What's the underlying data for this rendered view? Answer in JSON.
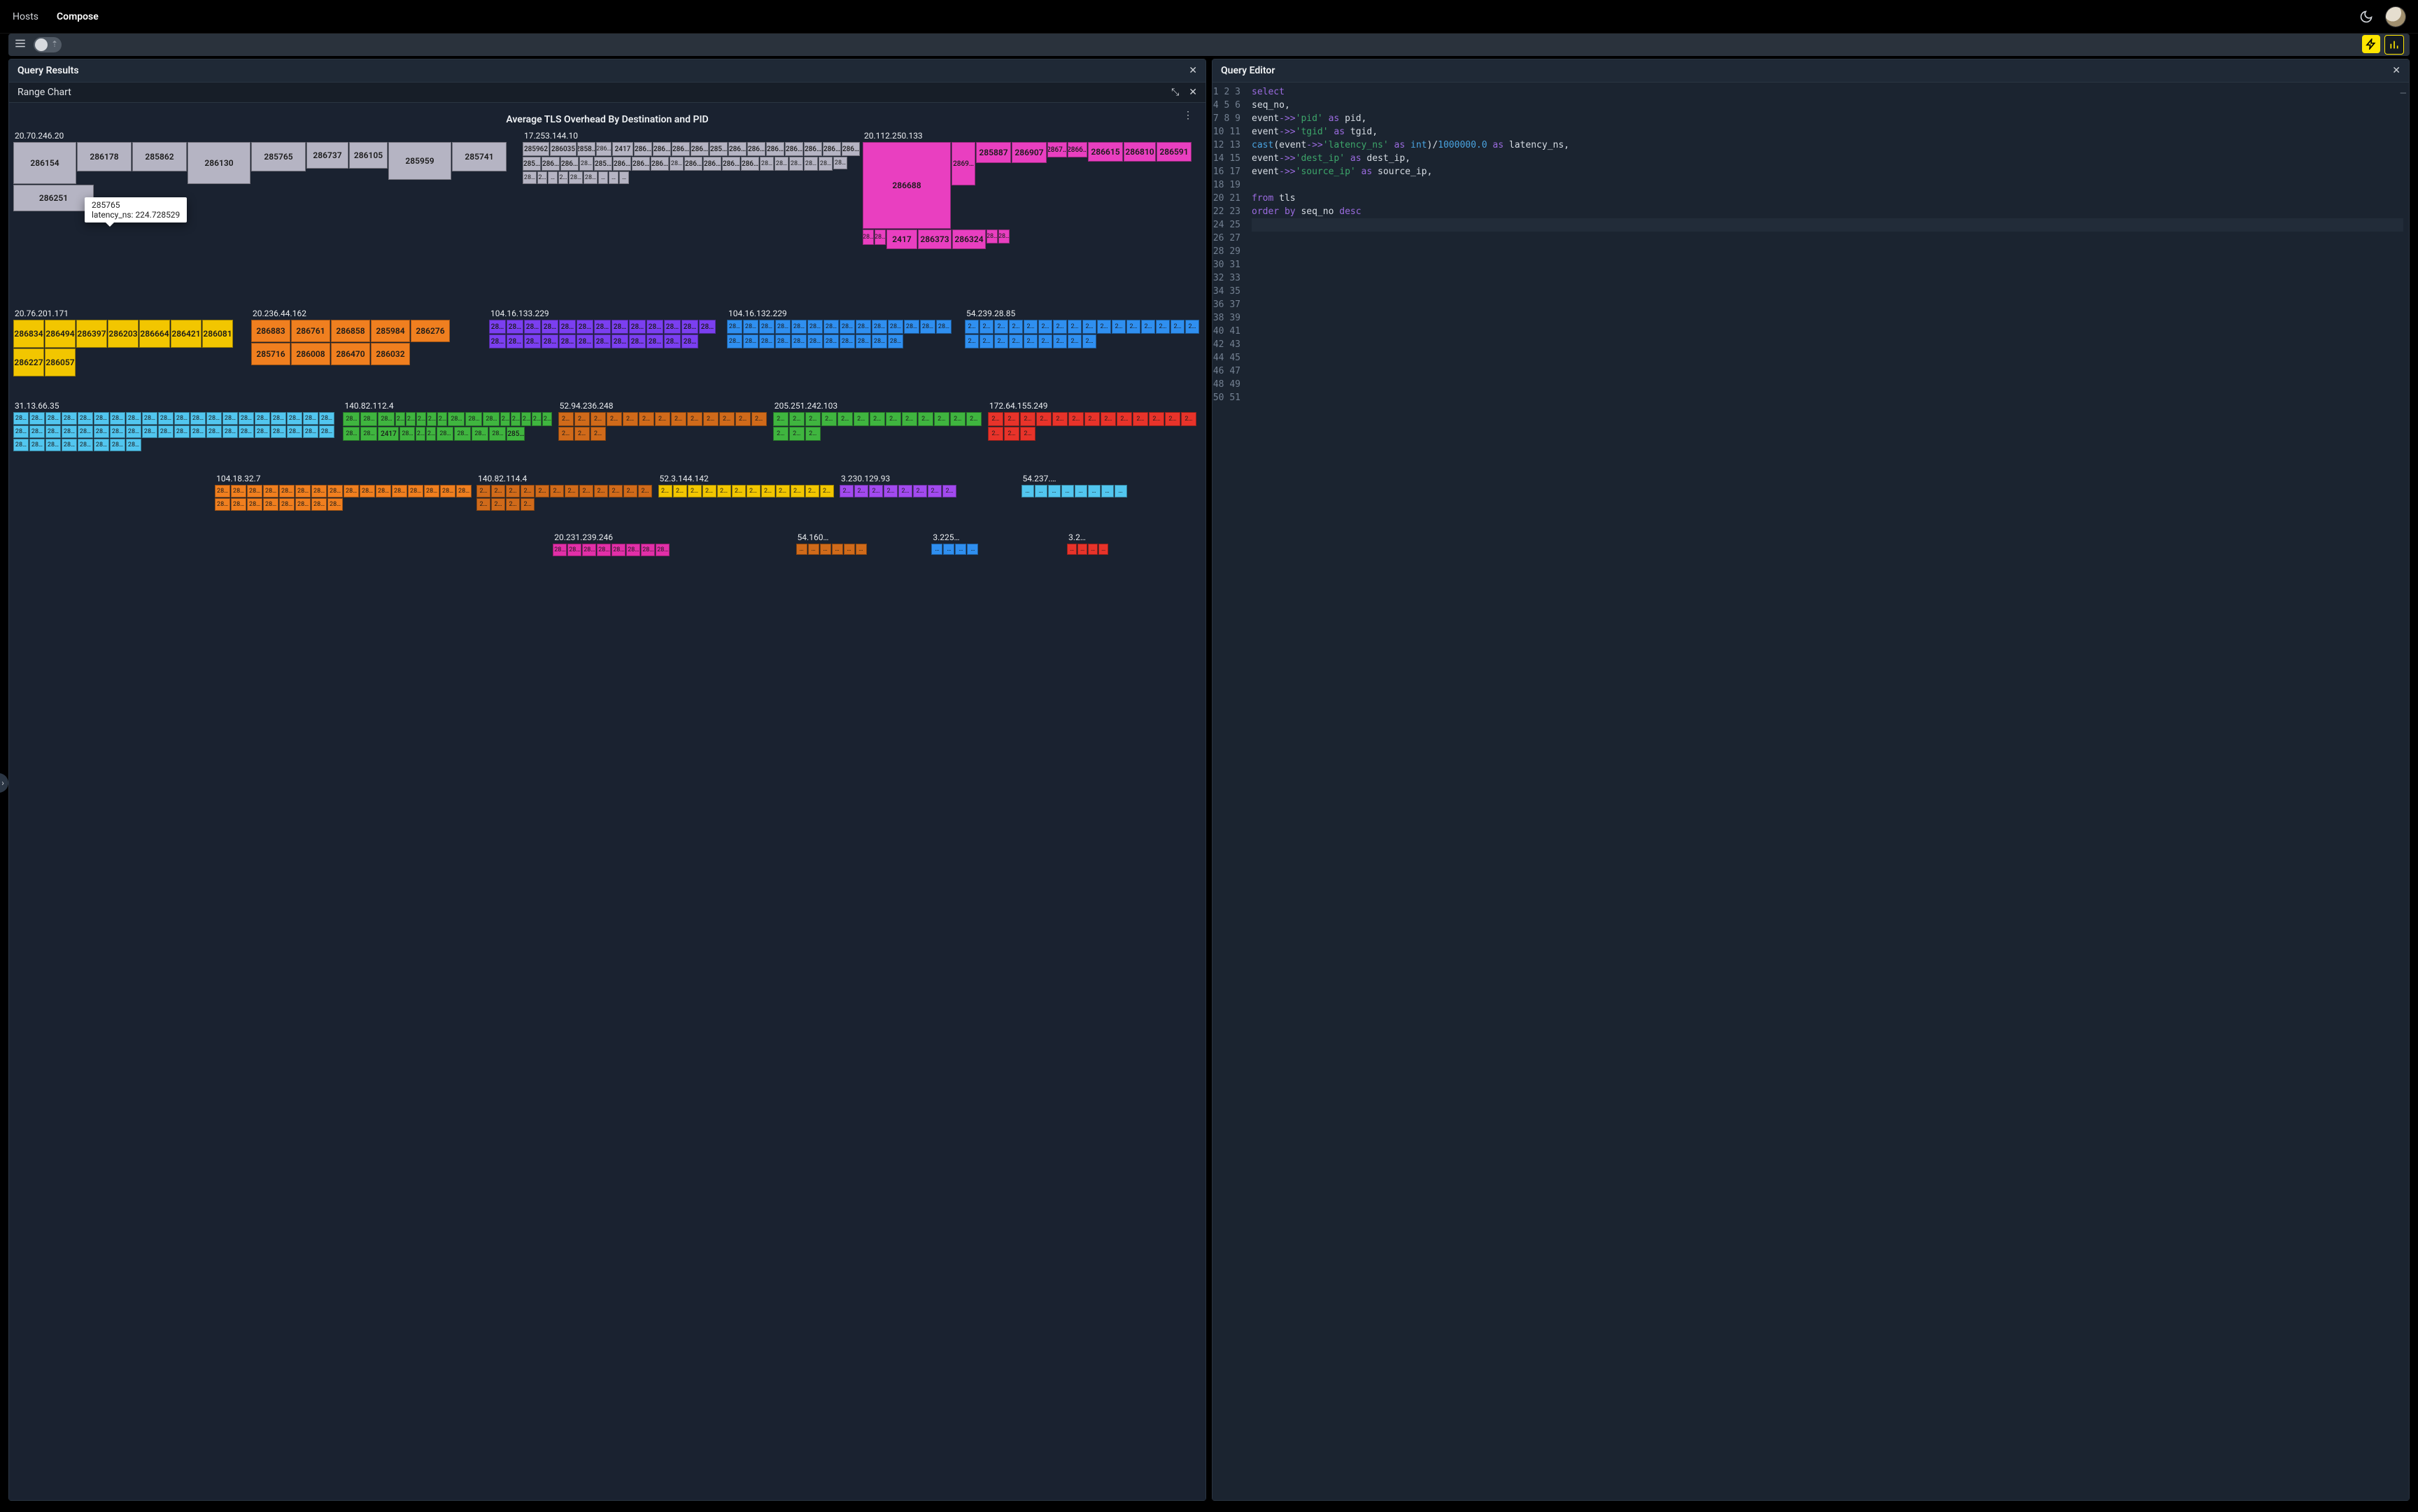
{
  "nav": {
    "hosts": "Hosts",
    "compose": "Compose"
  },
  "panes": {
    "results_title": "Query Results",
    "editor_title": "Query Editor",
    "chart_tab": "Range Chart"
  },
  "chart": {
    "title": "Average TLS Overhead By Destination and PID"
  },
  "tooltip": {
    "pid": "285765",
    "line": "latency_ns: 224.728529"
  },
  "query": {
    "lines": [
      "select",
      "seq_no,",
      "event->>'pid' as pid,",
      "event->>'tgid' as tgid,",
      "cast(event->>'latency_ns' as int)/1000000.0 as latency_ns,",
      "event->>'dest_ip' as dest_ip,",
      "event->>'source_ip' as source_ip,",
      "",
      "from tls",
      "order by seq_no desc",
      ""
    ],
    "total_lines": 51
  },
  "colors": {
    "c1": "#b5b4c3",
    "c2": "#b5b4c3",
    "c-pink": "#e93fc0",
    "c-orange": "#f07f1f",
    "c-yellow": "#f2c600",
    "c-blue": "#2f8ff0",
    "c-purple": "#7b3ff0",
    "c-sky": "#52c6ef",
    "c-green": "#3fb53f",
    "c-brown": "#d06a1a",
    "c-red": "#e8332a",
    "c-lpurple": "#a24aef",
    "c-teal": "#2fa5b7",
    "c-dpink": "#e22fa8"
  },
  "chart_data": {
    "type": "treemap",
    "title": "Average TLS Overhead By Destination and PID",
    "value_field": "latency_ns",
    "hover_example": {
      "pid": "285765",
      "latency_ns": 224.728529
    },
    "groups": [
      {
        "dest_ip": "20.70.246.20",
        "color": "c1",
        "size": "xl",
        "cells": [
          {
            "pid": "286154",
            "w": 90,
            "h": 60
          },
          {
            "pid": "286178",
            "w": 78,
            "h": 42
          },
          {
            "pid": "285862",
            "w": 78,
            "h": 42
          },
          {
            "pid": "286130",
            "w": 90,
            "h": 60
          },
          {
            "pid": "285765",
            "w": 78,
            "h": 42
          },
          {
            "pid": "286737",
            "w": 60,
            "h": 38
          },
          {
            "pid": "286105",
            "w": 55,
            "h": 38
          },
          {
            "pid": "285959",
            "w": 90,
            "h": 54
          },
          {
            "pid": "285741",
            "w": 78,
            "h": 42
          },
          {
            "pid": "286251",
            "w": 115,
            "h": 38
          }
        ]
      },
      {
        "dest_ip": "17.253.144.10",
        "color": "c1",
        "size": "l",
        "cells": [
          {
            "pid": "285962",
            "w": 38,
            "h": 20
          },
          {
            "pid": "286035",
            "w": 38,
            "h": 20
          },
          {
            "pid": "2858…",
            "w": 26,
            "h": 20
          },
          {
            "pid": "286…",
            "w": 22,
            "h": 20
          },
          {
            "pid": "2417",
            "w": 30,
            "h": 20
          },
          {
            "pid": "286…",
            "w": 26,
            "h": 20
          },
          {
            "pid": "286…",
            "w": 26,
            "h": 20
          },
          {
            "pid": "286…",
            "w": 26,
            "h": 20
          },
          {
            "pid": "286…",
            "w": 26,
            "h": 20
          },
          {
            "pid": "285…",
            "w": 26,
            "h": 20
          },
          {
            "pid": "286…",
            "w": 26,
            "h": 20
          },
          {
            "pid": "286…",
            "w": 26,
            "h": 20
          },
          {
            "pid": "286…",
            "w": 26,
            "h": 20
          },
          {
            "pid": "286…",
            "w": 26,
            "h": 20
          },
          {
            "pid": "286…",
            "w": 26,
            "h": 20
          },
          {
            "pid": "286…",
            "w": 26,
            "h": 20
          },
          {
            "pid": "286…",
            "w": 26,
            "h": 20
          },
          {
            "pid": "285…",
            "w": 26,
            "h": 20
          },
          {
            "pid": "286…",
            "w": 26,
            "h": 20
          },
          {
            "pid": "286…",
            "w": 26,
            "h": 20
          },
          {
            "pid": "28…",
            "w": 20,
            "h": 20
          },
          {
            "pid": "285…",
            "w": 26,
            "h": 20
          },
          {
            "pid": "286…",
            "w": 26,
            "h": 20
          },
          {
            "pid": "286…",
            "w": 26,
            "h": 20
          },
          {
            "pid": "286…",
            "w": 26,
            "h": 20
          },
          {
            "pid": "28…",
            "w": 20,
            "h": 20
          },
          {
            "pid": "286…",
            "w": 26,
            "h": 20
          },
          {
            "pid": "286…",
            "w": 26,
            "h": 20
          },
          {
            "pid": "286…",
            "w": 26,
            "h": 20
          },
          {
            "pid": "286…",
            "w": 26,
            "h": 20
          },
          {
            "pid": "28…",
            "w": 20,
            "h": 20
          },
          {
            "pid": "28…",
            "w": 20,
            "h": 20
          },
          {
            "pid": "28…",
            "w": 20,
            "h": 20
          },
          {
            "pid": "28…",
            "w": 20,
            "h": 20
          },
          {
            "pid": "28…",
            "w": 20,
            "h": 20
          },
          {
            "pid": "28…",
            "w": 20,
            "h": 18
          },
          {
            "pid": "28…",
            "w": 20,
            "h": 18
          },
          {
            "pid": "2…",
            "w": 14,
            "h": 18
          },
          {
            "pid": "…",
            "w": 14,
            "h": 18
          },
          {
            "pid": "2…",
            "w": 14,
            "h": 18
          },
          {
            "pid": "28…",
            "w": 20,
            "h": 18
          },
          {
            "pid": "28…",
            "w": 20,
            "h": 18
          },
          {
            "pid": "…",
            "w": 14,
            "h": 18
          },
          {
            "pid": "…",
            "w": 14,
            "h": 18
          },
          {
            "pid": "…",
            "w": 14,
            "h": 18
          }
        ]
      },
      {
        "dest_ip": "20.112.250.133",
        "color": "c-pink",
        "size": "l",
        "cells": [
          {
            "pid": "286688",
            "w": 126,
            "h": 124
          },
          {
            "pid": "2869…",
            "w": 34,
            "h": 62
          },
          {
            "pid": "285887",
            "w": 50,
            "h": 30
          },
          {
            "pid": "286907",
            "w": 50,
            "h": 30
          },
          {
            "pid": "2867…",
            "w": 28,
            "h": 22
          },
          {
            "pid": "2866…",
            "w": 28,
            "h": 22
          },
          {
            "pid": "286615",
            "w": 50,
            "h": 28
          },
          {
            "pid": "286810",
            "w": 46,
            "h": 28
          },
          {
            "pid": "286591",
            "w": 50,
            "h": 28
          },
          {
            "pid": "28…",
            "w": 16,
            "h": 22
          },
          {
            "pid": "28…",
            "w": 16,
            "h": 22
          },
          {
            "pid": "2417",
            "w": 44,
            "h": 28
          },
          {
            "pid": "286373",
            "w": 48,
            "h": 28
          },
          {
            "pid": "286324",
            "w": 48,
            "h": 28
          },
          {
            "pid": "28…",
            "w": 16,
            "h": 20
          },
          {
            "pid": "28…",
            "w": 16,
            "h": 20
          }
        ]
      },
      {
        "dest_ip": "20.76.201.171",
        "color": "c-yellow",
        "size": "m",
        "cells": [
          {
            "pid": "286834",
            "w": 44,
            "h": 40
          },
          {
            "pid": "286494",
            "w": 44,
            "h": 40
          },
          {
            "pid": "286397",
            "w": 44,
            "h": 40
          },
          {
            "pid": "286203",
            "w": 44,
            "h": 40
          },
          {
            "pid": "286664",
            "w": 44,
            "h": 40
          },
          {
            "pid": "286421",
            "w": 44,
            "h": 40
          },
          {
            "pid": "286081",
            "w": 44,
            "h": 40
          },
          {
            "pid": "286227",
            "w": 44,
            "h": 40
          },
          {
            "pid": "286057",
            "w": 44,
            "h": 40
          }
        ]
      },
      {
        "dest_ip": "20.236.44.162",
        "color": "c-orange",
        "size": "m",
        "cells": [
          {
            "pid": "286883",
            "w": 56,
            "h": 32
          },
          {
            "pid": "286761",
            "w": 56,
            "h": 32
          },
          {
            "pid": "286858",
            "w": 56,
            "h": 32
          },
          {
            "pid": "285984",
            "w": 56,
            "h": 32
          },
          {
            "pid": "286276",
            "w": 56,
            "h": 32
          },
          {
            "pid": "285716",
            "w": 56,
            "h": 32
          },
          {
            "pid": "286008",
            "w": 56,
            "h": 32
          },
          {
            "pid": "286470",
            "w": 56,
            "h": 32
          },
          {
            "pid": "286032",
            "w": 56,
            "h": 32
          }
        ]
      },
      {
        "dest_ip": "104.16.133.229",
        "color": "c-purple",
        "size": "m",
        "cells_fill": {
          "count": 25,
          "w": 24,
          "h": 20,
          "label": "28…"
        }
      },
      {
        "dest_ip": "104.16.132.229",
        "color": "c-blue",
        "size": "m",
        "cells_fill": {
          "count": 25,
          "w": 22,
          "h": 20,
          "label": "28…"
        }
      },
      {
        "dest_ip": "54.239.28.85",
        "color": "c-blue",
        "size": "m",
        "cells_fill": {
          "count": 25,
          "w": 20,
          "h": 20,
          "label": "2…"
        }
      },
      {
        "dest_ip": "140.82.112.4",
        "color": "c-green",
        "size": "m",
        "cells": [
          {
            "pid": "28…",
            "w": 24,
            "h": 20
          },
          {
            "pid": "28…",
            "w": 24,
            "h": 20
          },
          {
            "pid": "28…",
            "w": 24,
            "h": 20
          },
          {
            "pid": "2…",
            "w": 14,
            "h": 20
          },
          {
            "pid": "2…",
            "w": 14,
            "h": 20
          },
          {
            "pid": "2…",
            "w": 14,
            "h": 20
          },
          {
            "pid": "2…",
            "w": 14,
            "h": 20
          },
          {
            "pid": "2…",
            "w": 14,
            "h": 20
          },
          {
            "pid": "28…",
            "w": 24,
            "h": 20
          },
          {
            "pid": "28…",
            "w": 24,
            "h": 20
          },
          {
            "pid": "28…",
            "w": 24,
            "h": 20
          },
          {
            "pid": "2…",
            "w": 14,
            "h": 20
          },
          {
            "pid": "2…",
            "w": 14,
            "h": 20
          },
          {
            "pid": "2…",
            "w": 14,
            "h": 20
          },
          {
            "pid": "2…",
            "w": 14,
            "h": 20
          },
          {
            "pid": "2…",
            "w": 14,
            "h": 20
          },
          {
            "pid": "28…",
            "w": 24,
            "h": 20
          },
          {
            "pid": "28…",
            "w": 24,
            "h": 20
          },
          {
            "pid": "2417",
            "w": 30,
            "h": 20
          },
          {
            "pid": "28…",
            "w": 22,
            "h": 20
          },
          {
            "pid": "2…",
            "w": 14,
            "h": 20
          },
          {
            "pid": "2…",
            "w": 14,
            "h": 20
          },
          {
            "pid": "28…",
            "w": 24,
            "h": 20
          },
          {
            "pid": "28…",
            "w": 24,
            "h": 20
          },
          {
            "pid": "28…",
            "w": 24,
            "h": 20
          },
          {
            "pid": "28…",
            "w": 24,
            "h": 20
          },
          {
            "pid": "285…",
            "w": 26,
            "h": 20
          }
        ]
      },
      {
        "dest_ip": "52.94.236.248",
        "color": "c-brown",
        "size": "m",
        "cells_fill": {
          "count": 16,
          "w": 22,
          "h": 20,
          "label": "2…"
        }
      },
      {
        "dest_ip": "205.251.242.103",
        "color": "c-green",
        "size": "m",
        "cells_fill": {
          "count": 16,
          "w": 22,
          "h": 20,
          "label": "2…"
        }
      },
      {
        "dest_ip": "172.64.155.249",
        "color": "c-red",
        "size": "m",
        "cells_fill": {
          "count": 16,
          "w": 22,
          "h": 20,
          "label": "2…"
        }
      },
      {
        "dest_ip": "31.13.66.35",
        "color": "c-sky",
        "size": "l",
        "cells_fill": {
          "count": 48,
          "w": 22,
          "h": 18,
          "label": "28…"
        }
      },
      {
        "dest_ip": "104.18.32.7",
        "color": "c-orange",
        "size": "m",
        "cells_fill": {
          "count": 24,
          "w": 22,
          "h": 18,
          "label": "28…"
        }
      },
      {
        "dest_ip": "140.82.114.4",
        "color": "c-brown",
        "size": "s",
        "cells_fill": {
          "count": 16,
          "w": 20,
          "h": 18,
          "label": "2…"
        }
      },
      {
        "dest_ip": "52.3.144.142",
        "color": "c-yellow",
        "size": "s",
        "cells_fill": {
          "count": 12,
          "w": 20,
          "h": 18,
          "label": "2…"
        }
      },
      {
        "dest_ip": "3.230.129.93",
        "color": "c-lpurple",
        "size": "s",
        "cells_fill": {
          "count": 8,
          "w": 20,
          "h": 18,
          "label": "2…"
        }
      },
      {
        "dest_ip": "54.237.…",
        "color": "c-sky",
        "size": "s",
        "cells_fill": {
          "count": 8,
          "w": 18,
          "h": 18,
          "label": "…"
        }
      },
      {
        "dest_ip": "20.231.239.246",
        "color": "c-dpink",
        "size": "s",
        "cells_fill": {
          "count": 8,
          "w": 20,
          "h": 18,
          "label": "28…"
        }
      },
      {
        "dest_ip": "54.160…",
        "color": "c-brown",
        "size": "xs",
        "cells_fill": {
          "count": 6,
          "w": 16,
          "h": 16,
          "label": "…"
        }
      },
      {
        "dest_ip": "3.225…",
        "color": "c-blue",
        "size": "xs",
        "cells_fill": {
          "count": 4,
          "w": 16,
          "h": 16,
          "label": "…"
        }
      },
      {
        "dest_ip": "3.2…",
        "color": "c-red",
        "size": "xs",
        "cells_fill": {
          "count": 4,
          "w": 14,
          "h": 16,
          "label": "…"
        }
      }
    ]
  }
}
